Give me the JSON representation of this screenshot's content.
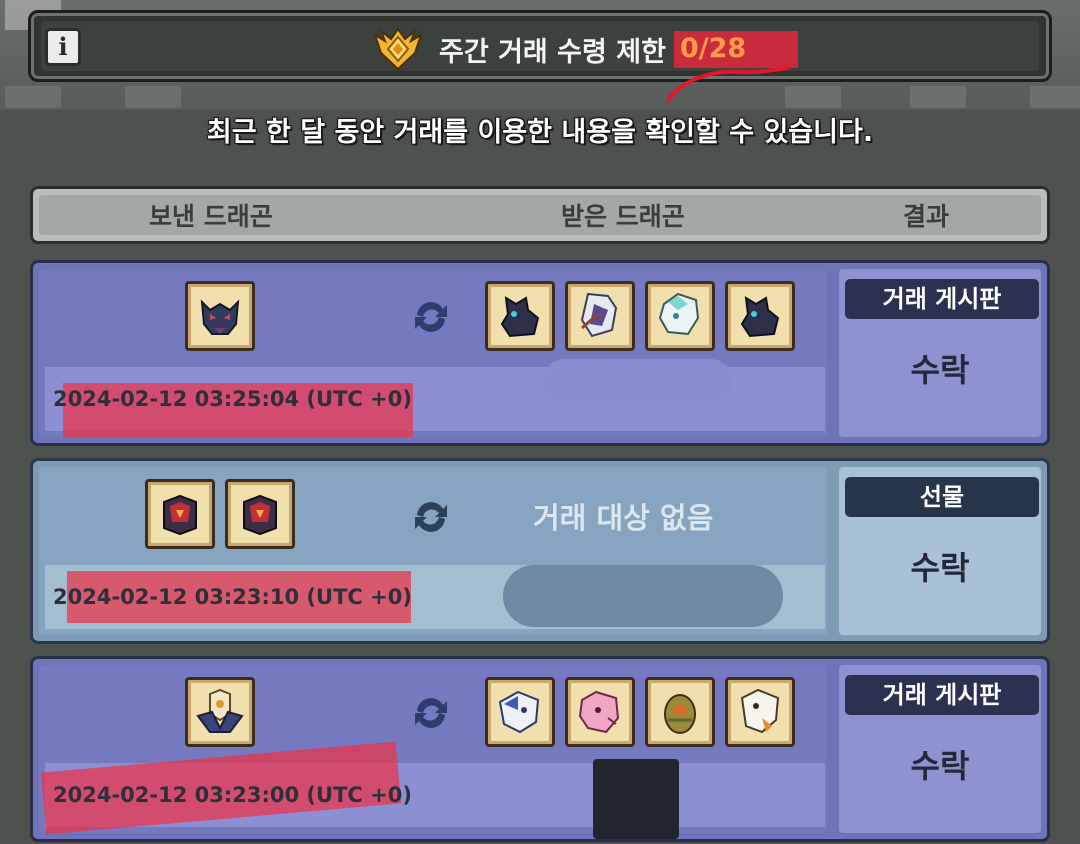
{
  "header": {
    "title": "주간 거래 수령 제한",
    "count": "0/28",
    "info_icon": "info-icon",
    "medal_icon": "gold-medal-icon"
  },
  "subtitle": "최근 한 달 동안 거래를 이용한 내용을 확인할 수 있습니다.",
  "columns": {
    "sent": "보낸 드래곤",
    "received": "받은 드래곤",
    "result": "결과"
  },
  "trades": [
    {
      "date": "2024-02-12 03:25:04 (UTC +0)",
      "type": "거래 게시판",
      "status": "수락",
      "sent_icons": [
        "dark-dragon-head-icon"
      ],
      "received_icons": [
        "black-dragon-icon",
        "white-rider-dragon-icon",
        "cyan-white-dragon-icon",
        "black-dragon-icon"
      ]
    },
    {
      "date": "2024-02-12 03:23:10 (UTC +0)",
      "type": "선물",
      "status": "수락",
      "sent_icons": [
        "crimson-armor-dragon-icon",
        "crimson-armor-dragon-icon"
      ],
      "received_empty": "거래 대상 없음"
    },
    {
      "date": "2024-02-12 03:23:00 (UTC +0)",
      "type": "거래 게시판",
      "status": "수락",
      "sent_icons": [
        "winged-egg-dragon-icon"
      ],
      "received_icons": [
        "blue-white-dragon-icon",
        "pink-dragon-icon",
        "dragon-egg-icon",
        "white-orange-dragon-icon"
      ]
    }
  ],
  "colors": {
    "accent_count": "#ff9b4a",
    "row_purple": "#7479c0",
    "row_blue": "#86a4bf"
  }
}
